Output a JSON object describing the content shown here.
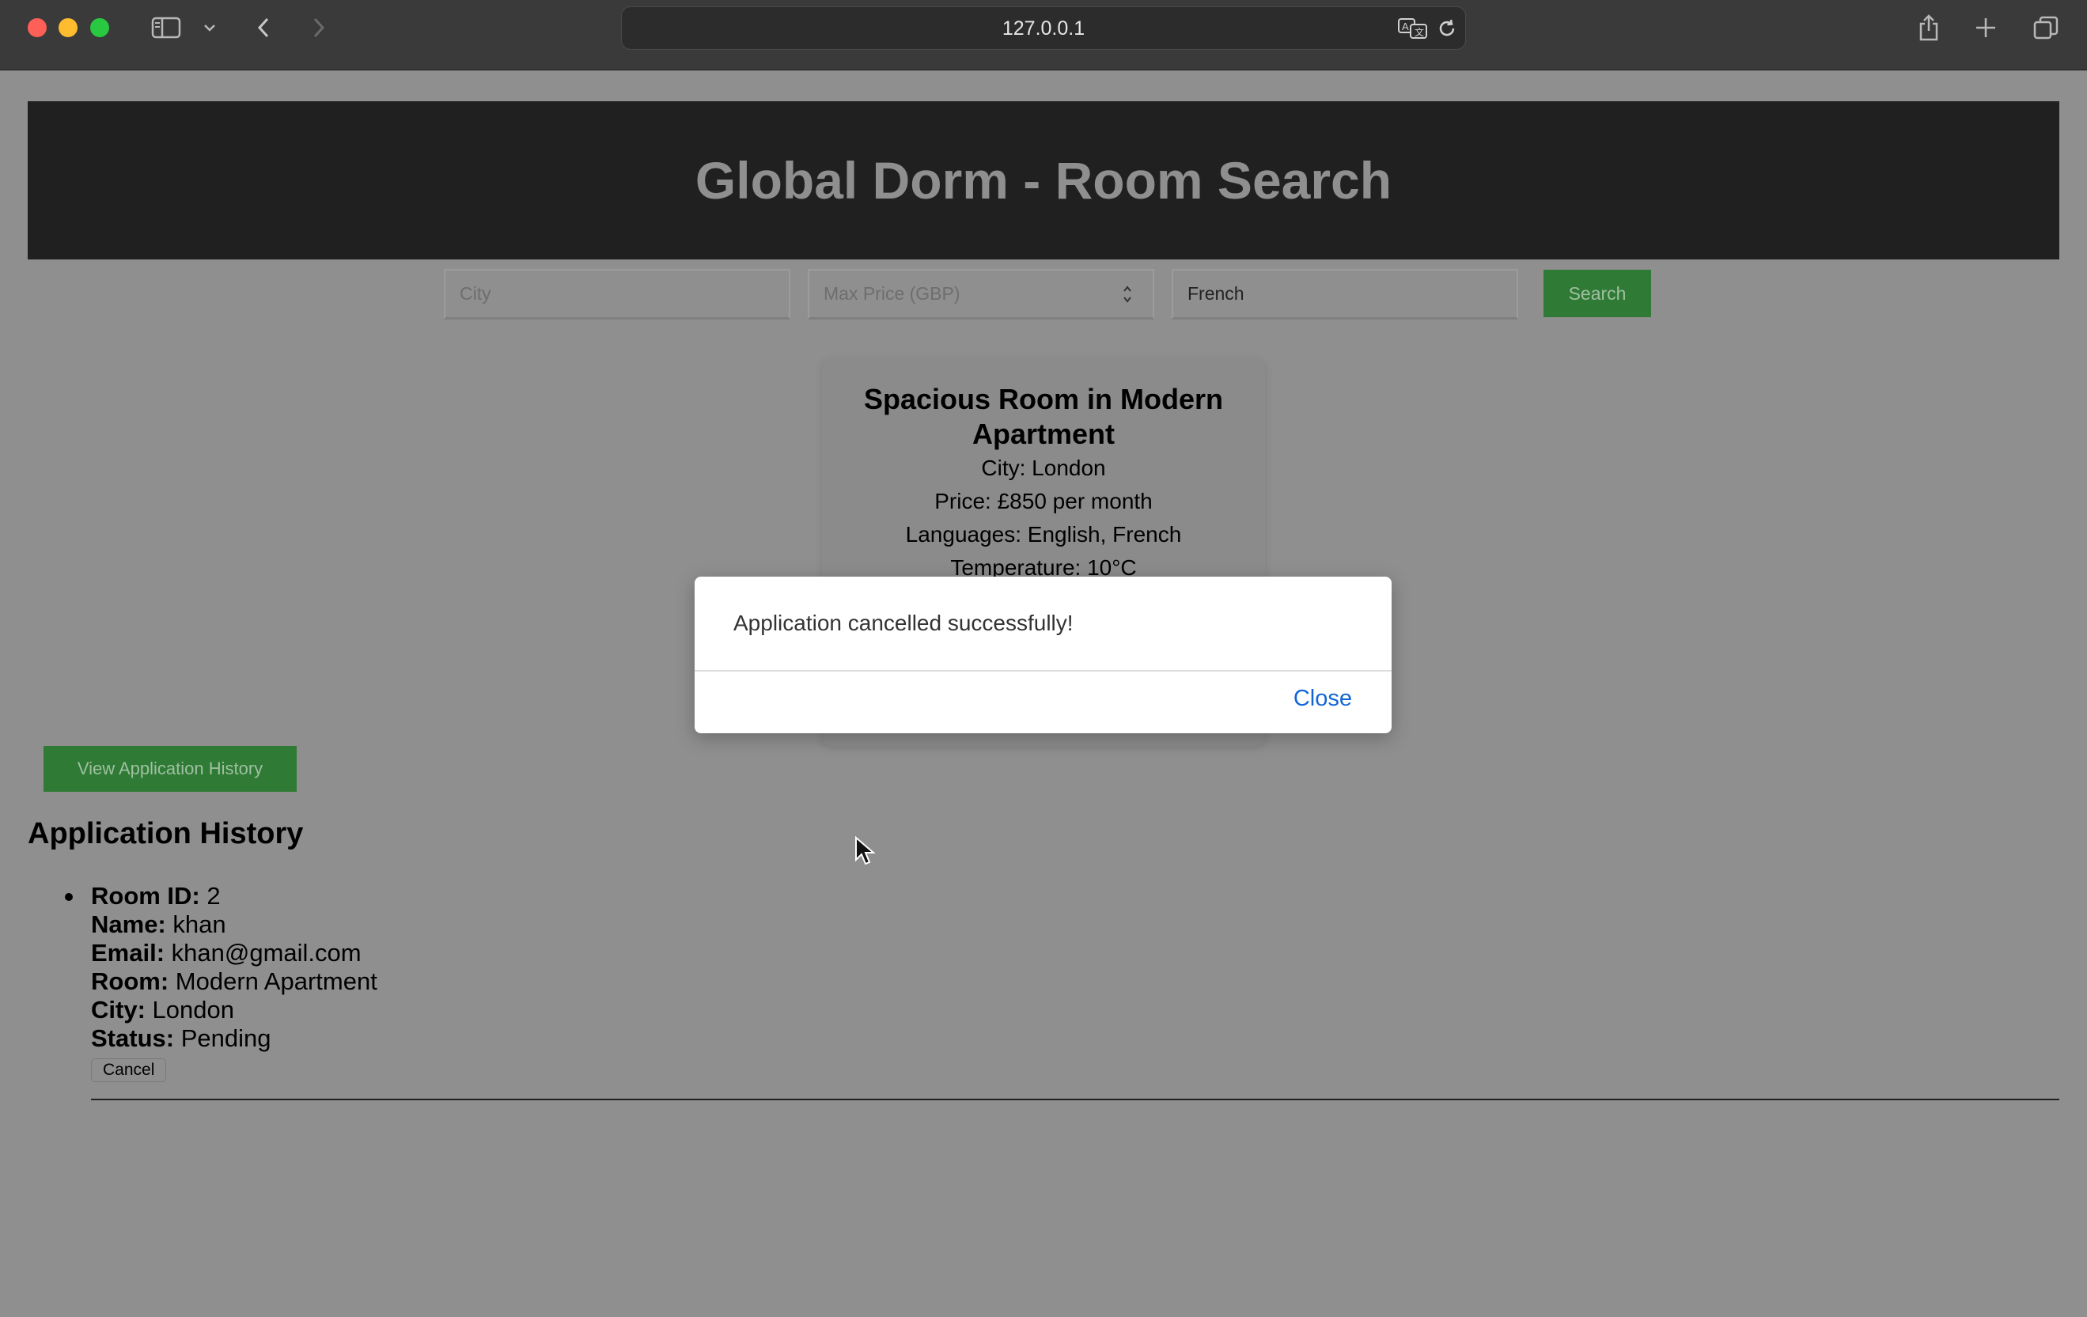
{
  "browser": {
    "url": "127.0.0.1",
    "icons": [
      "sidebar-icon",
      "chevron-down-icon",
      "back-icon",
      "forward-icon",
      "translate-icon",
      "reload-icon",
      "share-icon",
      "new-tab-icon",
      "tabs-overview-icon"
    ]
  },
  "header": {
    "title": "Global Dorm - Room Search"
  },
  "search": {
    "city_placeholder": "City",
    "city_value": "",
    "price_placeholder": "Max Price (GBP)",
    "price_value": "",
    "language_placeholder": "",
    "language_value": "French",
    "button_label": "Search"
  },
  "room_card": {
    "title": "Spacious Room in Modern Apartment",
    "lines": [
      "City: London",
      "Price: £850 per month",
      "Languages: English, French",
      "Temperature: 10°C"
    ]
  },
  "history": {
    "button_label": "View Application History",
    "title": "Application History",
    "items": [
      {
        "room_id_label": "Room ID:",
        "room_id": "2",
        "name_label": "Name:",
        "name": "khan",
        "email_label": "Email:",
        "email": "khan@gmail.com",
        "room_label": "Room:",
        "room": "Modern Apartment",
        "city_label": "City:",
        "city": "London",
        "status_label": "Status:",
        "status": "Pending",
        "cancel_label": "Cancel"
      }
    ]
  },
  "modal": {
    "message": "Application cancelled successfully!",
    "close_label": "Close"
  },
  "colors": {
    "accent_green": "#2f7a35",
    "link_blue": "#1166d6",
    "header_bg": "#202020"
  }
}
